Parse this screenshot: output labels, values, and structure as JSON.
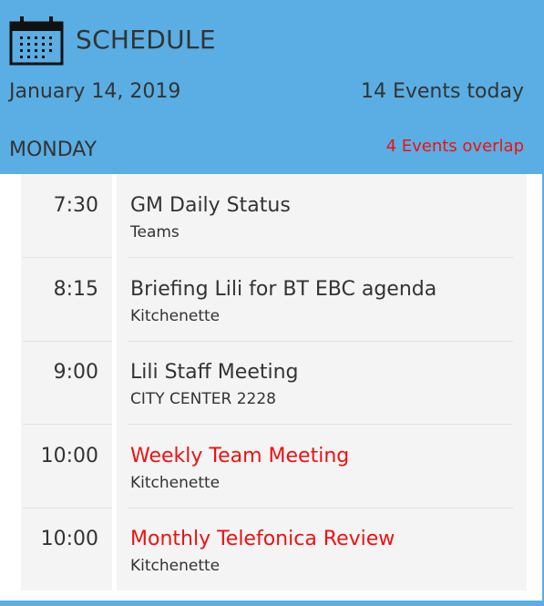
{
  "header": {
    "icon": "calendar-icon",
    "title": "SCHEDULE",
    "date": "January 14, 2019",
    "events_count": "14 Events today",
    "weekday": "MONDAY",
    "overlap_notice": "4 Events overlap"
  },
  "colors": {
    "header_bg": "#5aaee3",
    "overlap_red": "#ee1111",
    "text": "#333333",
    "row_bg": "#f4f4f4"
  },
  "events": [
    {
      "time": "7:30",
      "title": "GM Daily Status",
      "location": "Teams",
      "overlap": false
    },
    {
      "time": "8:15",
      "title": "Briefing Lili for BT EBC agenda",
      "location": "Kitchenette",
      "overlap": false
    },
    {
      "time": "9:00",
      "title": "Lili Staff Meeting",
      "location": "CITY CENTER 2228",
      "overlap": false
    },
    {
      "time": "10:00",
      "title": "Weekly Team Meeting",
      "location": "Kitchenette",
      "overlap": true
    },
    {
      "time": "10:00",
      "title": "Monthly Telefonica Review",
      "location": "Kitchenette",
      "overlap": true
    }
  ]
}
